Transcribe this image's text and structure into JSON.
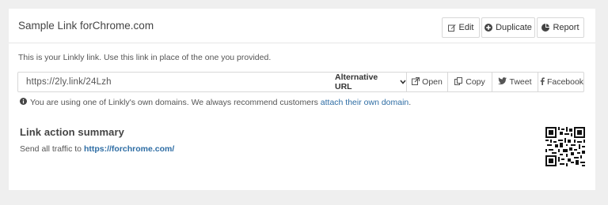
{
  "header": {
    "title": "Sample Link forChrome.com",
    "buttons": [
      {
        "label": "Edit",
        "icon": "edit-icon"
      },
      {
        "label": "Duplicate",
        "icon": "plus-circle-icon"
      },
      {
        "label": "Report",
        "icon": "pie-chart-icon"
      }
    ]
  },
  "intro": "This is your Linkly link. Use this link in place of the one you provided.",
  "linkbar": {
    "url": "https://2ly.link/24Lzh",
    "alt_url_label": "Alternative URL",
    "actions": [
      {
        "label": "Open",
        "icon": "external-link-icon"
      },
      {
        "label": "Copy",
        "icon": "copy-icon"
      },
      {
        "label": "Tweet",
        "icon": "twitter-icon"
      },
      {
        "label": "Facebook",
        "icon": "facebook-icon"
      }
    ]
  },
  "notice": {
    "text": "You are using one of Linkly's own domains. We always recommend customers",
    "link_text": "attach their own domain",
    "suffix": "."
  },
  "summary": {
    "title": "Link action summary",
    "prefix": "Send all traffic to ",
    "destination": "https://forchrome.com/"
  },
  "colors": {
    "link": "#2e6da4",
    "background": "#efefef"
  }
}
